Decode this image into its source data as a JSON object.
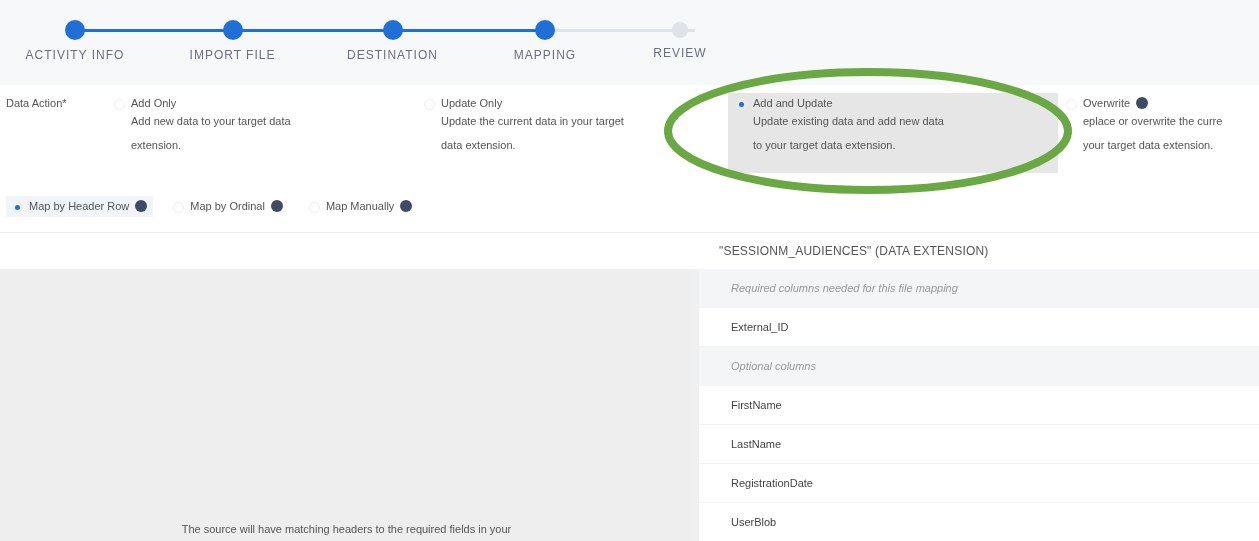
{
  "steps": [
    {
      "label": "ACTIVITY INFO",
      "completed": true
    },
    {
      "label": "IMPORT FILE",
      "completed": true
    },
    {
      "label": "DESTINATION",
      "completed": true
    },
    {
      "label": "MAPPING",
      "completed": true
    },
    {
      "label": "REVIEW",
      "completed": false
    }
  ],
  "data_action": {
    "label": "Data Action*",
    "options": [
      {
        "title": "Add Only",
        "lines": [
          "Add new data to your target data",
          "extension."
        ],
        "selected": false,
        "info": false
      },
      {
        "title": "Update Only",
        "lines": [
          "Update the current data in your target",
          "data extension."
        ],
        "selected": false,
        "info": false
      },
      {
        "title": "Add and Update",
        "lines": [
          "Update existing data and add new data",
          "to your target data extension."
        ],
        "selected": true,
        "info": false
      },
      {
        "title": "Overwrite",
        "lines": [
          "eplace or overwrite the curre",
          "your target data extension."
        ],
        "selected": false,
        "info": true
      }
    ]
  },
  "map_options": [
    {
      "label": "Map by Header Row",
      "selected": true
    },
    {
      "label": "Map by Ordinal",
      "selected": false
    },
    {
      "label": "Map Manually",
      "selected": false
    }
  ],
  "source_panel": {
    "message": "The source will have matching headers to the required fields in your"
  },
  "target_panel": {
    "title": "\"SESSIONM_AUDIENCES\" (DATA EXTENSION)",
    "rows": [
      {
        "kind": "section",
        "text": "Required columns needed for this file mapping"
      },
      {
        "kind": "field",
        "text": "External_ID"
      },
      {
        "kind": "section",
        "text": "Optional columns"
      },
      {
        "kind": "field",
        "text": "FirstName"
      },
      {
        "kind": "field",
        "text": "LastName"
      },
      {
        "kind": "field",
        "text": "RegistrationDate"
      },
      {
        "kind": "field",
        "text": "UserBlob"
      }
    ]
  },
  "annotation": {
    "kind": "ellipse",
    "color": "#6aa844"
  }
}
